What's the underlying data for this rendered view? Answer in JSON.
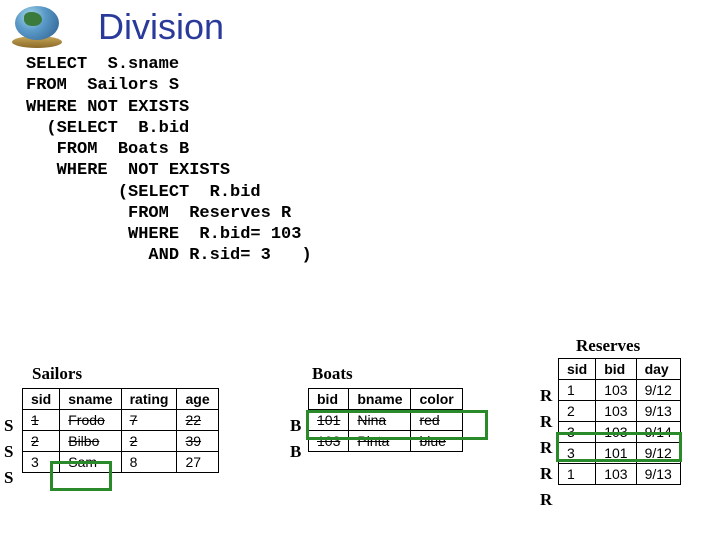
{
  "title": "Division",
  "sql": {
    "l1": "SELECT  S.sname",
    "l2": "FROM  Sailors S",
    "l3": "WHERE NOT EXISTS",
    "l4": "  (SELECT  B.bid",
    "l5": "   FROM  Boats B",
    "l6": "   WHERE  NOT EXISTS",
    "l7": "         (SELECT  R.bid",
    "l8": "          FROM  Reserves R",
    "l9a": "          WHERE  R.bid=",
    "l9b": "103",
    "l10a": "            AND R.sid=",
    "l10b": "3",
    "l10c": ")"
  },
  "tables": {
    "reserves": {
      "title": "Reserves",
      "label": "R",
      "headers": [
        "sid",
        "bid",
        "day"
      ],
      "rows": [
        [
          "1",
          "103",
          "9/12"
        ],
        [
          "2",
          "103",
          "9/13"
        ],
        [
          "3",
          "103",
          "9/14"
        ],
        [
          "3",
          "101",
          "9/12"
        ],
        [
          "1",
          "103",
          "9/13"
        ]
      ]
    },
    "sailors": {
      "title": "Sailors",
      "label": "S",
      "headers": [
        "sid",
        "sname",
        "rating",
        "age"
      ],
      "rows": [
        [
          "1",
          "Frodo",
          "7",
          "22"
        ],
        [
          "2",
          "Bilbo",
          "2",
          "39"
        ],
        [
          "3",
          "Sam",
          "8",
          "27"
        ]
      ]
    },
    "boats": {
      "title": "Boats",
      "label": "B",
      "headers": [
        "bid",
        "bname",
        "color"
      ],
      "rows": [
        [
          "101",
          "Nina",
          "red"
        ],
        [
          "103",
          "Pinta",
          "blue"
        ]
      ]
    }
  }
}
